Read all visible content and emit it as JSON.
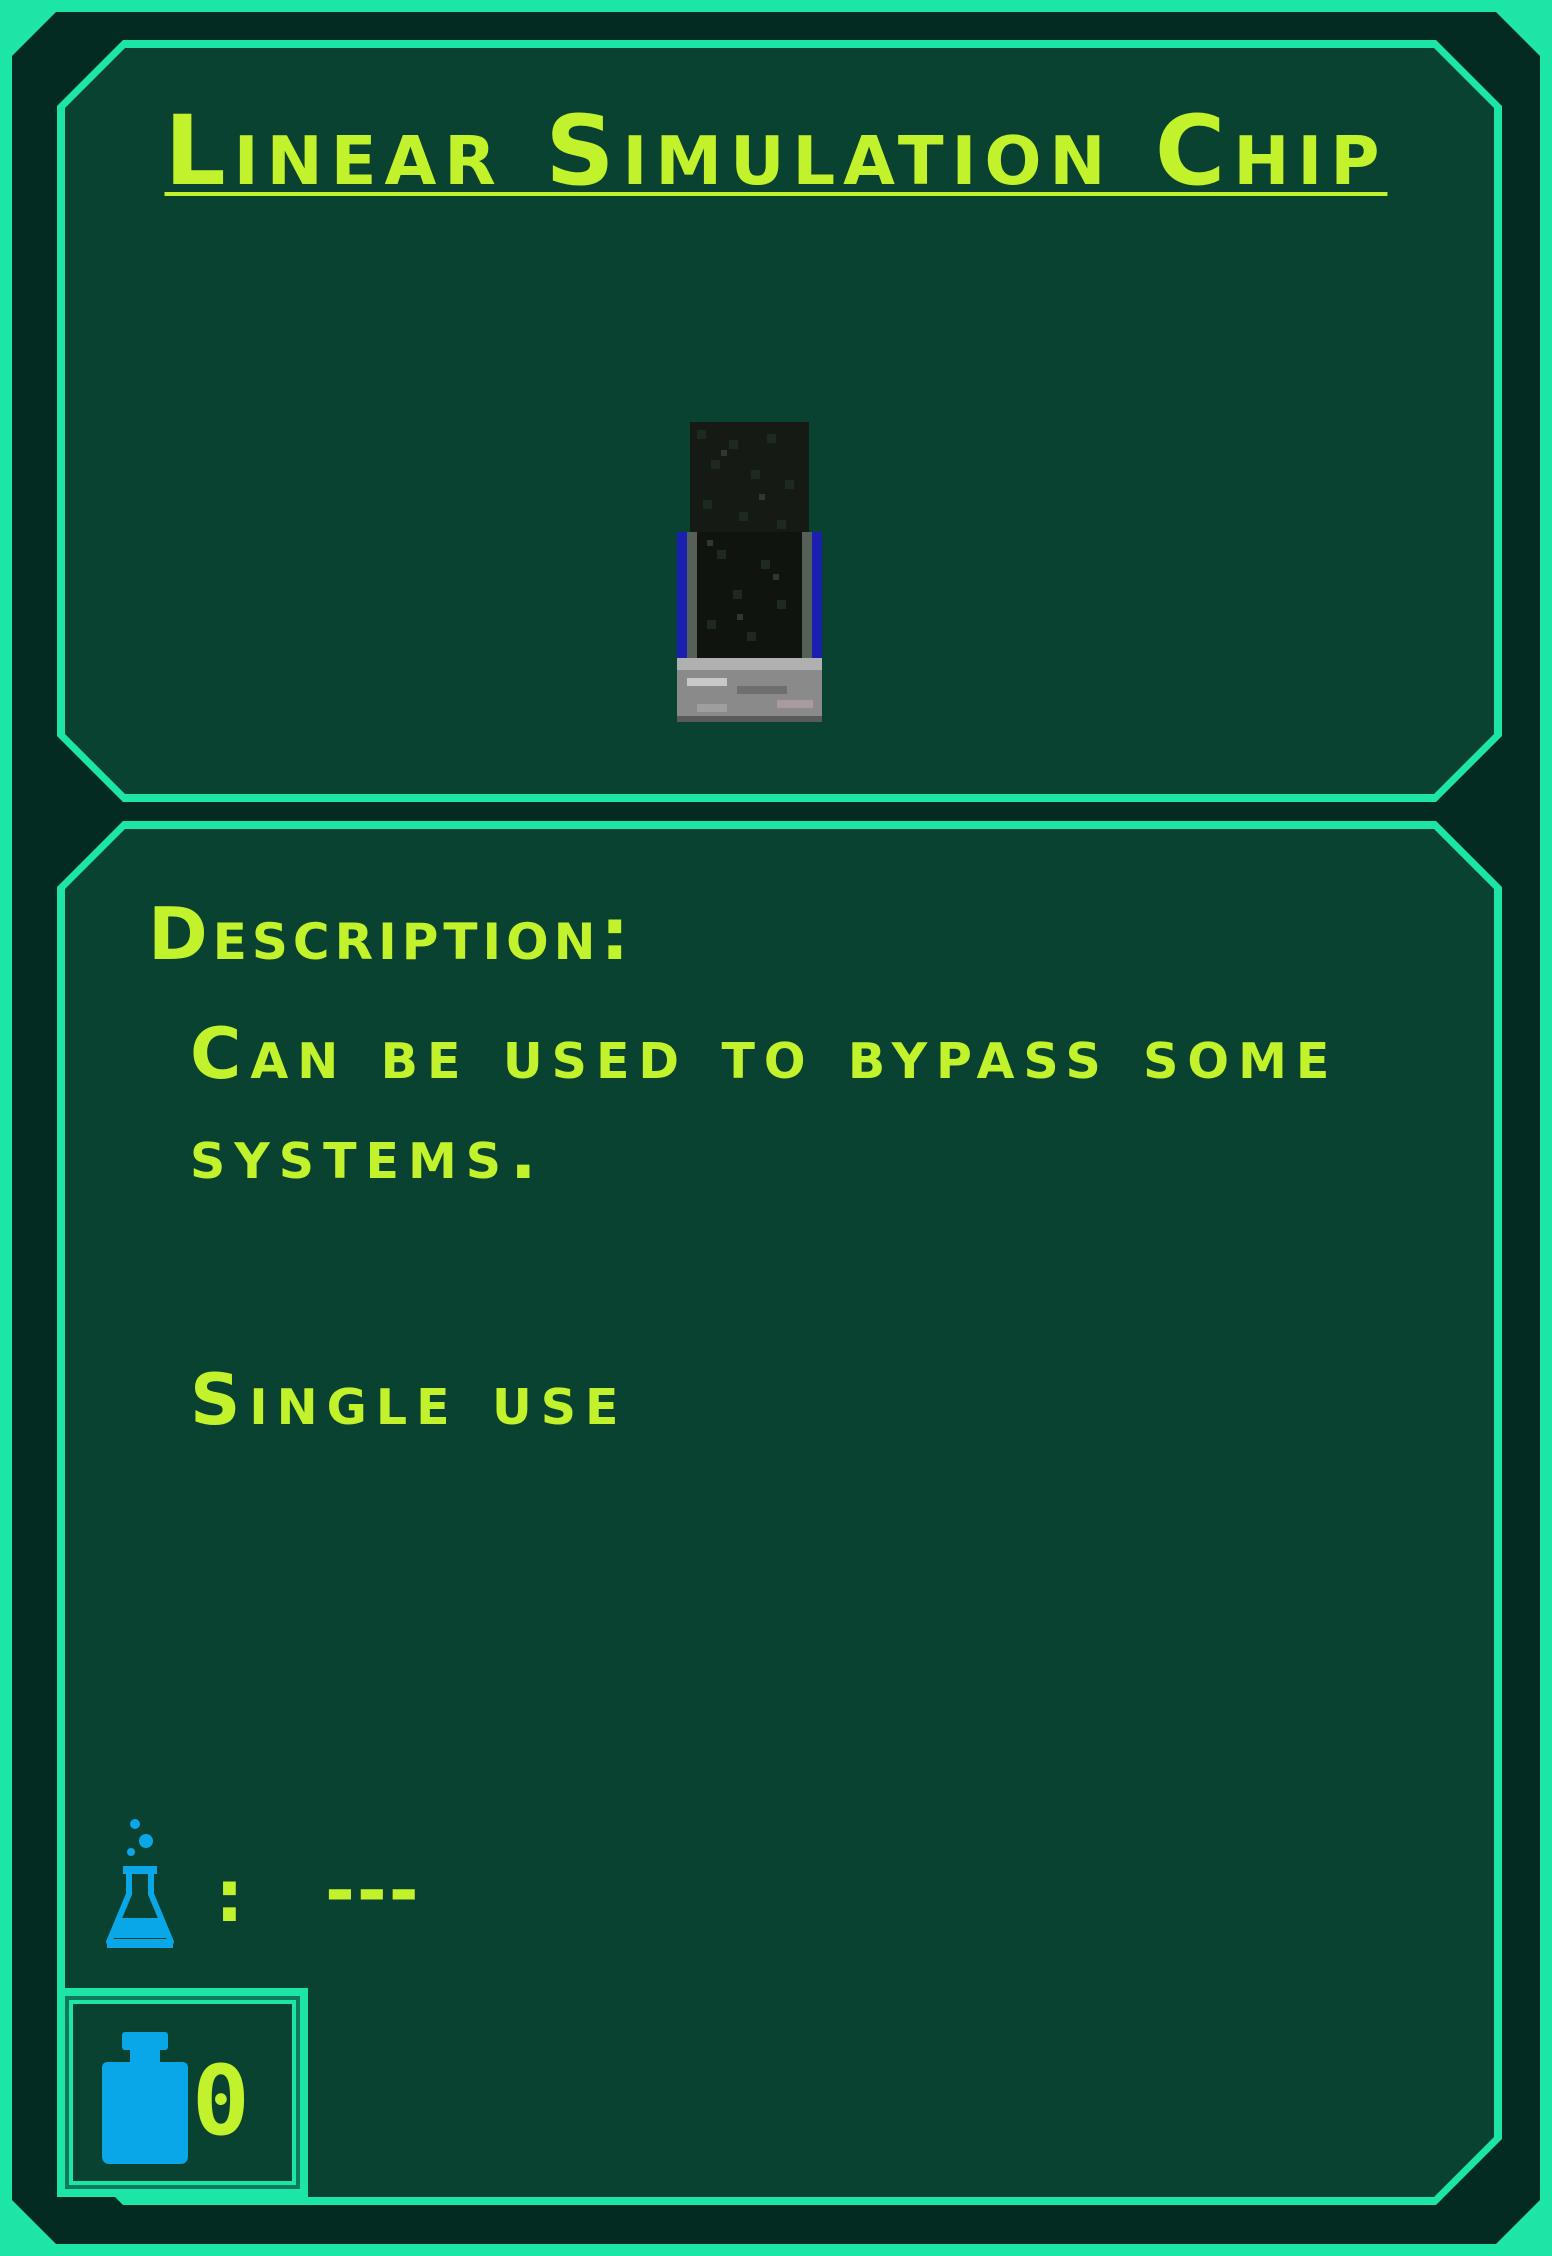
{
  "item": {
    "title": "Linear Simulation Chip",
    "icon": "simulation-chip-icon"
  },
  "description": {
    "heading": "Description:",
    "body": "Can be used to bypass some systems.",
    "extra": "Single use"
  },
  "stats": {
    "research_icon": "flask-icon",
    "research_separator": ":",
    "research_value": "---",
    "weight_icon": "weight-icon",
    "weight_value": "0"
  },
  "colors": {
    "accent_text": "#c2f22b",
    "border": "#1de5a6",
    "panel_bg": "#0a4232",
    "frame_bg": "#042b22",
    "icon_blue": "#0aa7e8"
  }
}
